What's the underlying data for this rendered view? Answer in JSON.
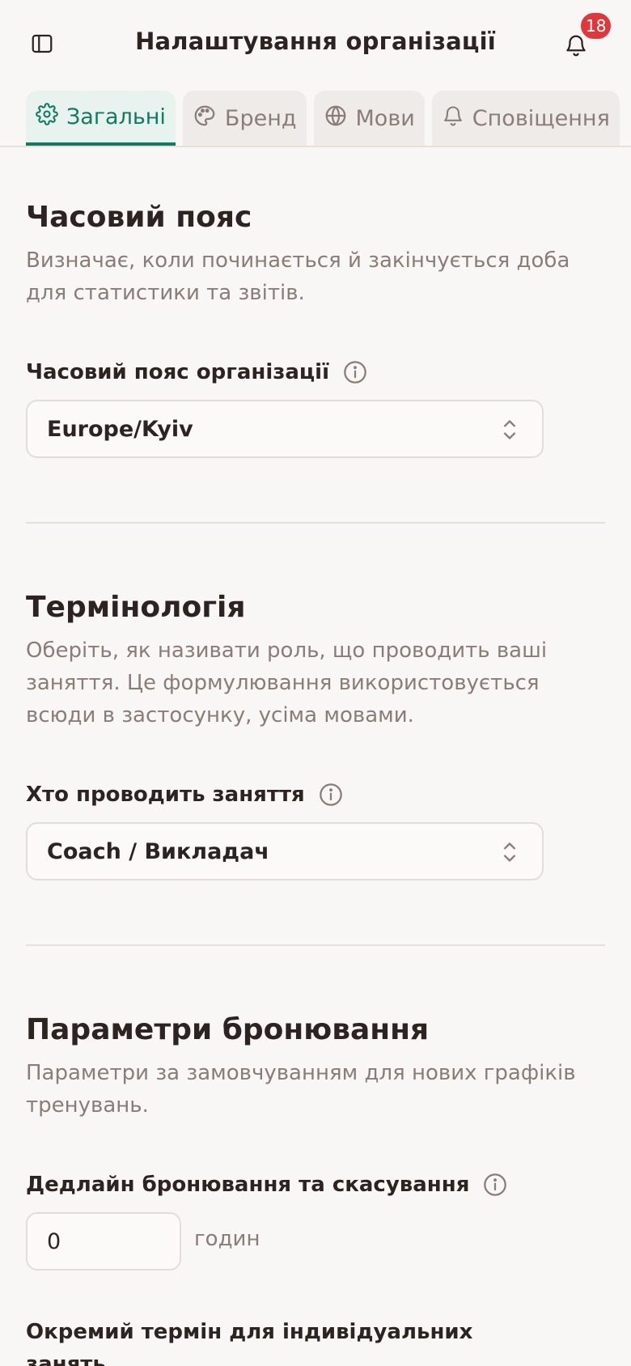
{
  "header": {
    "title": "Налаштування організації",
    "notification_count": "18",
    "icons": {
      "sidebar": "sidebar-toggle-icon",
      "bell": "bell-icon"
    }
  },
  "tabs": [
    {
      "label": "Загальні",
      "icon": "gear-icon",
      "active": true
    },
    {
      "label": "Бренд",
      "icon": "palette-icon",
      "active": false
    },
    {
      "label": "Мови",
      "icon": "globe-icon",
      "active": false
    },
    {
      "label": "Сповіщення",
      "icon": "bell-icon",
      "active": false
    }
  ],
  "timezone": {
    "title": "Часовий пояс",
    "description": "Визначає, коли починається й закінчується доба для статистики та звітів.",
    "field_label": "Часовий пояс організації",
    "value": "Europe/Kyiv"
  },
  "terminology": {
    "title": "Термінологія",
    "description": "Оберіть, як називати роль, що проводить ваші заняття. Це формулювання використовується всюди в застосунку, усіма мовами.",
    "field_label": "Хто проводить заняття",
    "value": "Coach / Викладач"
  },
  "booking": {
    "title": "Параметри бронювання",
    "description": "Параметри за замовчуванням для нових графіків тренувань.",
    "deadline_label": "Дедлайн бронювання та скасування",
    "deadline_value": "0",
    "deadline_unit": "годин",
    "individual_label": "Окремий термін для індивідуальних занять"
  },
  "colors": {
    "accent": "#137a62",
    "badge": "#e0373a",
    "text": "#2d2422",
    "muted": "#8a7d78",
    "background": "#f9f7f5"
  }
}
